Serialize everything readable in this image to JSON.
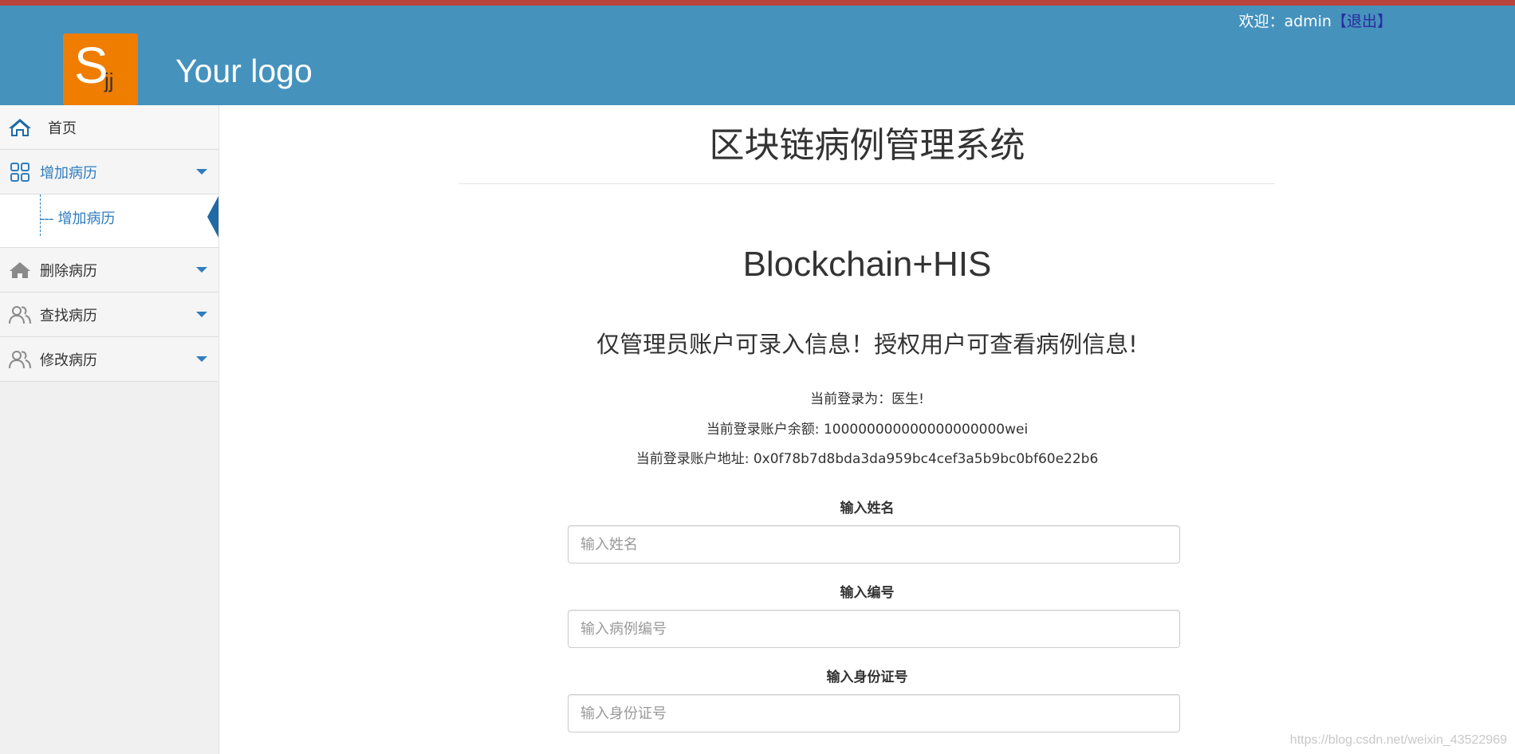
{
  "header": {
    "logo_letter": "S",
    "logo_sub": "jj",
    "logo_text": "Your logo",
    "welcome_prefix": "欢迎：admin",
    "logout_label": "【退出】"
  },
  "sidebar": {
    "home": "首页",
    "items": [
      {
        "label": "增加病历",
        "icon": "grid-icon",
        "sub": [
          "增加病历"
        ]
      },
      {
        "label": "删除病历",
        "icon": "home-icon"
      },
      {
        "label": "查找病历",
        "icon": "users-icon"
      },
      {
        "label": "修改病历",
        "icon": "users-icon"
      }
    ],
    "sub_dash": "---"
  },
  "main": {
    "title": "区块链病例管理系统",
    "subtitle": "Blockchain+HIS",
    "notice": "仅管理员账户可录入信息！授权用户可查看病例信息!",
    "login_role": "当前登录为：医生!",
    "balance": "当前登录账户余额: 100000000000000000000wei",
    "address": "当前登录账户地址: 0x0f78b7d8bda3da959bc4cef3a5b9bc0bf60e22b6",
    "fields": [
      {
        "label": "输入姓名",
        "placeholder": "输入姓名"
      },
      {
        "label": "输入编号",
        "placeholder": "输入病例编号"
      },
      {
        "label": "输入身份证号",
        "placeholder": "输入身份证号"
      }
    ]
  },
  "watermark": "https://blog.csdn.net/weixin_43522969",
  "colors": {
    "header": "#4592bd",
    "logo": "#ef7d00",
    "accent": "#2f7dbf"
  }
}
